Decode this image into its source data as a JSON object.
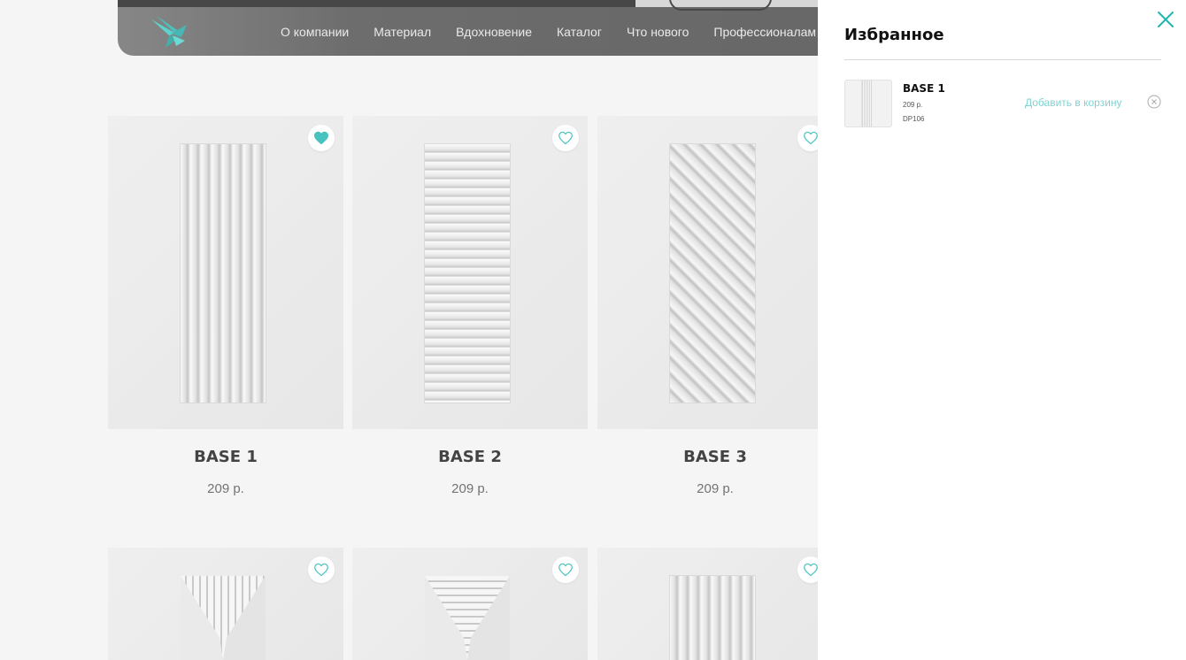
{
  "nav": {
    "items": [
      {
        "label": "О компании"
      },
      {
        "label": "Материал"
      },
      {
        "label": "Вдохновение"
      },
      {
        "label": "Каталог"
      },
      {
        "label": "Что нового"
      },
      {
        "label": "Профессионалам"
      }
    ]
  },
  "products": [
    {
      "title": "BASE 1",
      "price": "209 р.",
      "favorited": true
    },
    {
      "title": "BASE 2",
      "price": "209 р.",
      "favorited": false
    },
    {
      "title": "BASE 3",
      "price": "209 р.",
      "favorited": false
    }
  ],
  "drawer": {
    "title": "Избранное",
    "items": [
      {
        "name": "BASE 1",
        "price": "209 р.",
        "code": "DP106",
        "add_to_cart_label": "Добавить в корзину"
      }
    ]
  },
  "colors": {
    "accent": "#20b5b0",
    "accent_light": "#7fd4d0",
    "nav_bg": "#4a4a4a"
  },
  "icons": {
    "logo": "swallow-logo-icon",
    "favorite_filled": "heart-filled-icon",
    "favorite_empty": "heart-outline-icon",
    "close": "close-icon",
    "remove": "remove-circle-icon"
  }
}
